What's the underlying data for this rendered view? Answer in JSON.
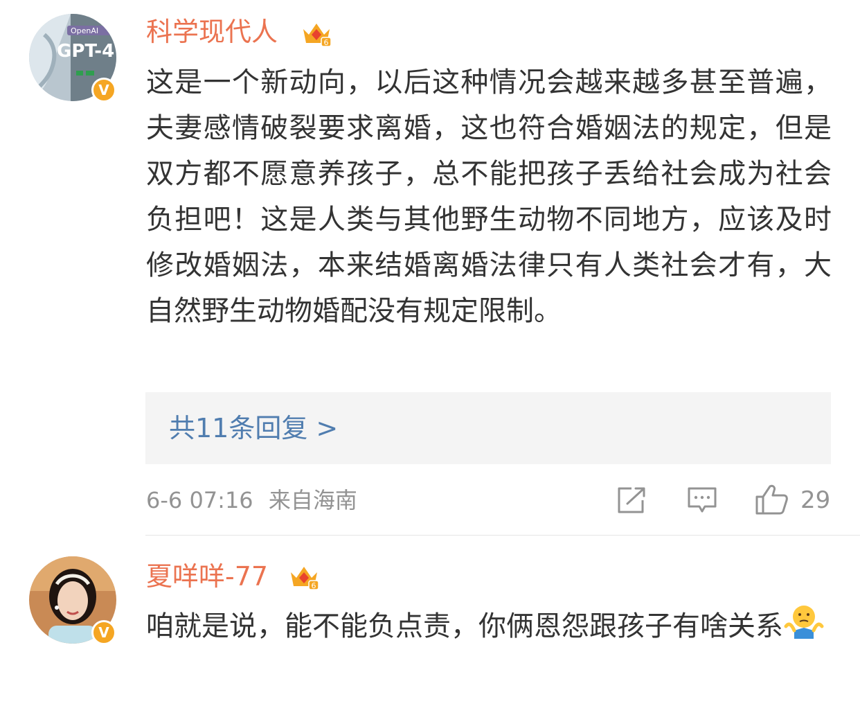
{
  "comments": [
    {
      "username": "科学现代人",
      "level_badge": "6",
      "verified_badge": "V",
      "avatar_text_brand": "OpenAI",
      "avatar_text_model": "GPT-4",
      "text": "这是一个新动向，以后这种情况会越来越多甚至普遍，夫妻感情破裂要求离婚，这也符合婚姻法的规定，但是双方都不愿意养孩子，总不能把孩子丢给社会成为社会负担吧！这是人类与其他野生动物不同地方，应该及时修改婚姻法，本来结婚离婚法律只有人类社会才有，大自然野生动物婚配没有规定限制。",
      "reply_link": "共11条回复 >",
      "time": "6-6 07:16",
      "location": "来自海南",
      "like_count": "29"
    },
    {
      "username": "夏咩咩-77",
      "level_badge": "6",
      "verified_badge": "V",
      "text": "咱就是说，能不能负点责，你俩恩怨跟孩子有啥关系",
      "emoji": "shrug-emoji"
    }
  ],
  "colors": {
    "username": "#eb7350",
    "link": "#507daf",
    "meta": "#939393",
    "text": "#333333",
    "badge": "#f5a623"
  },
  "icons": [
    "share-icon",
    "comment-icon",
    "like-icon",
    "crown-level-icon",
    "verified-icon"
  ]
}
